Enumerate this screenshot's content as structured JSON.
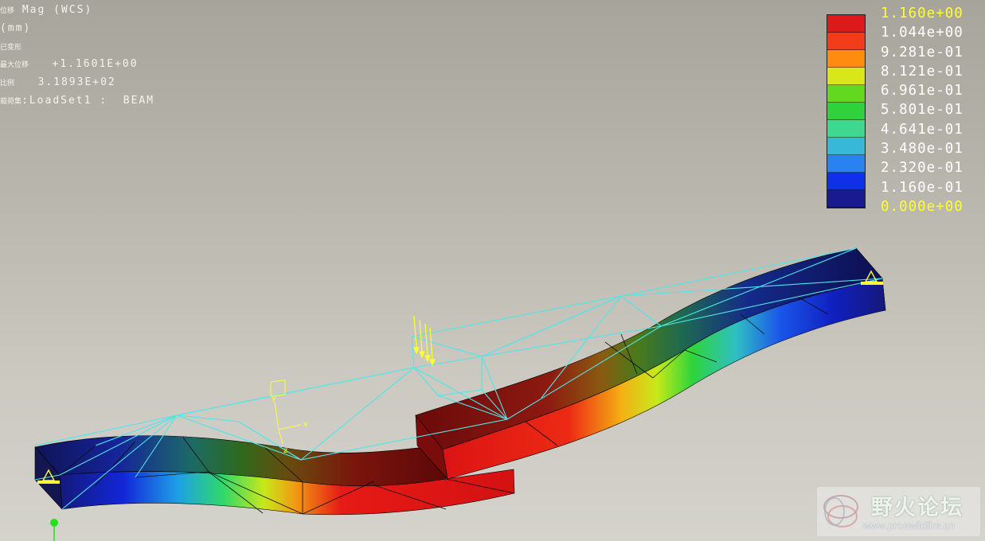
{
  "info": {
    "line1_label": "位移",
    "line1_value": " Mag (WCS)",
    "line2_value": "(mm)",
    "line3_label": "已变形",
    "line4_label": "最大位移",
    "line4_value": "   +1.1601E+00",
    "line5_label": "比例",
    "line5_value": "   3.1893E+02",
    "line6_label": "载荷集",
    "line6_value": ":LoadSet1 :  BEAM"
  },
  "legend": {
    "labels": [
      "1.160e+00",
      "1.044e+00",
      "9.281e-01",
      "8.121e-01",
      "6.961e-01",
      "5.801e-01",
      "4.641e-01",
      "3.480e-01",
      "2.320e-01",
      "1.160e-01",
      "0.000e+00"
    ],
    "label_colors": [
      "#ffff33",
      "#ffffff",
      "#ffffff",
      "#ffffff",
      "#ffffff",
      "#ffffff",
      "#ffffff",
      "#ffffff",
      "#ffffff",
      "#ffffff",
      "#ffff33"
    ],
    "band_colors": [
      "#dd1a1a",
      "#f23c18",
      "#ff8c10",
      "#d8e61a",
      "#62d81e",
      "#2fd23c",
      "#3fd890",
      "#38b8d8",
      "#2a82f0",
      "#1030e8",
      "#1a1a90"
    ]
  },
  "model": {
    "max_displacement": 1.1601,
    "deformation_scale": 318.93,
    "mesh_color": "#4fe6ea",
    "constraint_color": "#ffff33",
    "csys_labels": {
      "y": "y",
      "x": "x",
      "z": "z"
    }
  },
  "watermark": {
    "title": "野火论坛",
    "url": "www.proewildfire.cn"
  }
}
